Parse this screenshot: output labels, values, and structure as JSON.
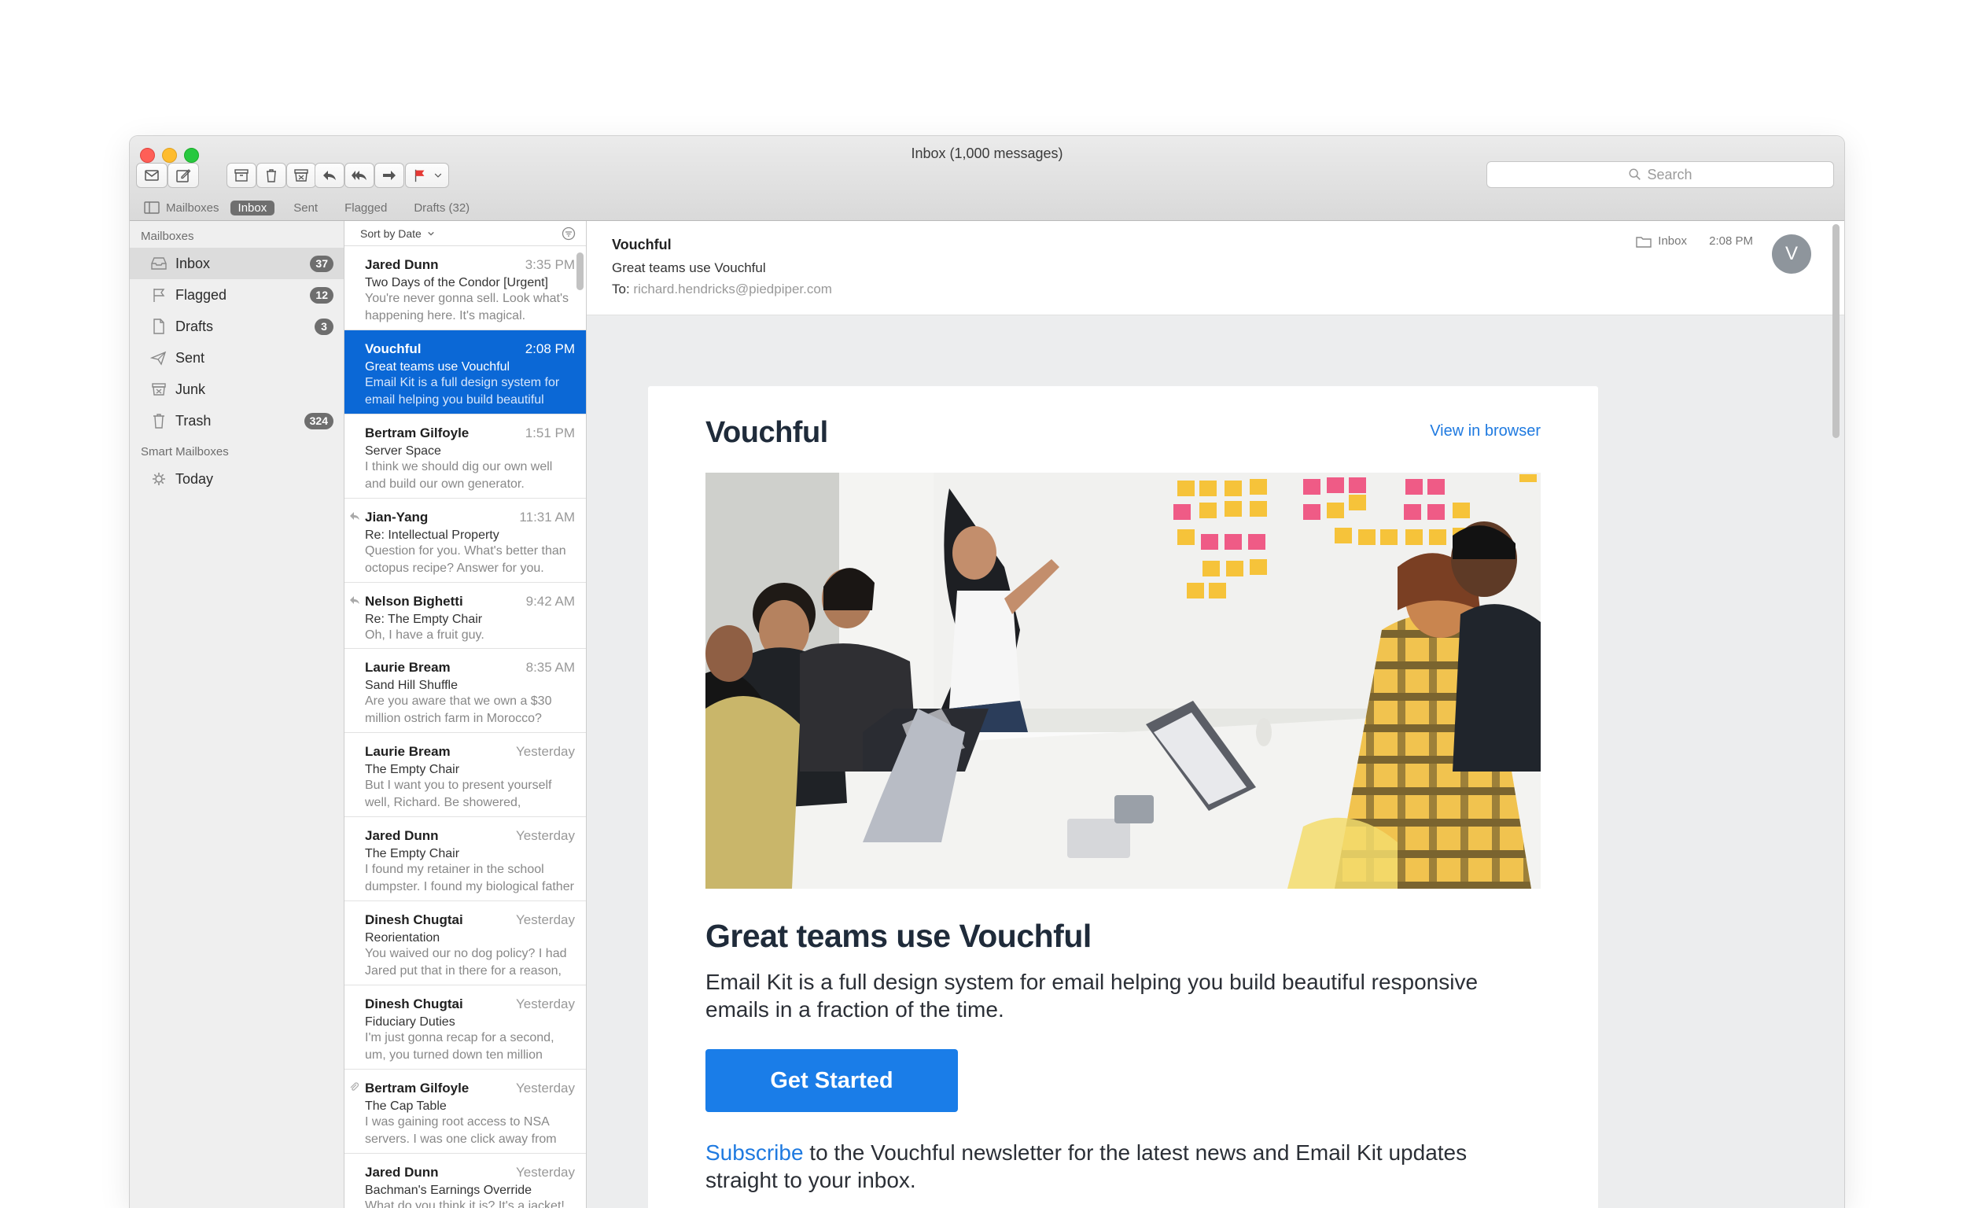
{
  "window": {
    "title": "Inbox (1,000 messages)"
  },
  "toolbar": {
    "buttons": [
      "get-mail-icon",
      "compose-icon",
      "archive-icon",
      "trash-icon",
      "junk-icon",
      "reply-icon",
      "reply-all-icon",
      "forward-icon",
      "flag-icon"
    ],
    "search_placeholder": "Search"
  },
  "favorites": {
    "items": [
      {
        "label": "Mailboxes"
      },
      {
        "label": "Inbox",
        "active": true
      },
      {
        "label": "Sent"
      },
      {
        "label": "Flagged"
      },
      {
        "label": "Drafts (32)"
      }
    ]
  },
  "sidebar": {
    "section_mailboxes": "Mailboxes",
    "items": [
      {
        "label": "Inbox",
        "badge": "37",
        "icon": "inbox-icon"
      },
      {
        "label": "Flagged",
        "badge": "12",
        "icon": "flag-icon"
      },
      {
        "label": "Drafts",
        "badge": "3",
        "icon": "document-icon"
      },
      {
        "label": "Sent",
        "badge": "",
        "icon": "paper-plane-icon"
      },
      {
        "label": "Junk",
        "badge": "",
        "icon": "junk-icon"
      },
      {
        "label": "Trash",
        "badge": "324",
        "icon": "trash-icon"
      }
    ],
    "section_smart": "Smart Mailboxes",
    "smart_items": [
      {
        "label": "Today",
        "icon": "gear-icon"
      }
    ]
  },
  "message_list": {
    "sort_label": "Sort by Date",
    "messages": [
      {
        "from": "Jared Dunn",
        "time": "3:35 PM",
        "subject": "Two Days of the Condor [Urgent]",
        "preview": "You're never gonna sell. Look what's happening here. It's magical."
      },
      {
        "from": "Vouchful",
        "time": "2:08 PM",
        "subject": "Great teams use Vouchful",
        "preview": "Email Kit is a full design system for email helping you build beautiful responsive emails in a fraction…",
        "selected": true
      },
      {
        "from": "Bertram Gilfoyle",
        "time": "1:51 PM",
        "subject": "Server Space",
        "preview": "I think we should dig our own well and build our own generator."
      },
      {
        "from": "Jian-Yang",
        "time": "11:31 AM",
        "subject": "Re: Intellectual Property",
        "preview": "Question for you. What's better than octopus recipe? Answer for you. Eight recipes for octopus.",
        "replied": true
      },
      {
        "from": "Nelson Bighetti",
        "time": "9:42 AM",
        "subject": "Re: The Empty Chair",
        "preview": "Oh, I have a fruit guy.",
        "replied": true
      },
      {
        "from": "Laurie Bream",
        "time": "8:35 AM",
        "subject": "Sand Hill Shuffle",
        "preview": "Are you aware that we own a $30 million ostrich farm in Morocco?"
      },
      {
        "from": "Laurie Bream",
        "time": "Yesterday",
        "subject": "The Empty Chair",
        "preview": "But I want you to present yourself well, Richard. Be showered, groomed, well-dressed."
      },
      {
        "from": "Jared Dunn",
        "time": "Yesterday",
        "subject": "The Empty Chair",
        "preview": "I found my retainer in the school dumpster. I found my biological father in a militia up in the Ozarks."
      },
      {
        "from": "Dinesh Chugtai",
        "time": "Yesterday",
        "subject": "Reorientation",
        "preview": "You waived our no dog policy? I had Jared put that in there for a reason, Richard!"
      },
      {
        "from": "Dinesh Chugtai",
        "time": "Yesterday",
        "subject": "Fiduciary Duties",
        "preview": "I'm just gonna recap for a second, um, you turned down ten million dollars."
      },
      {
        "from": "Bertram Gilfoyle",
        "time": "Yesterday",
        "subject": "The Cap Table",
        "preview": "I was gaining root access to NSA servers. I was one click away from starting a second Iranian revolution.",
        "attachment": true
      },
      {
        "from": "Jared Dunn",
        "time": "Yesterday",
        "subject": "Bachman's Earnings Override",
        "preview": "What do you think it is? It's a jacket!"
      }
    ]
  },
  "reader": {
    "from": "Vouchful",
    "subject": "Great teams use Vouchful",
    "to_label": "To:",
    "to_address": "richard.hendricks@piedpiper.com",
    "mailbox": "Inbox",
    "time": "2:08 PM",
    "avatar_initial": "V"
  },
  "email": {
    "brand": "Vouchful",
    "view_in_browser": "View in browser",
    "headline": "Great teams use Vouchful",
    "body": "Email Kit is a full design system for email helping you build beautiful responsive emails in a fraction of the time.",
    "cta": "Get Started",
    "subscribe_link": "Subscribe",
    "subscribe_rest": " to the Vouchful newsletter for the latest news and Email Kit updates straight to your inbox."
  },
  "colors": {
    "selection": "#0b68d6",
    "link": "#1f7ae0",
    "cta": "#1a7de8"
  }
}
